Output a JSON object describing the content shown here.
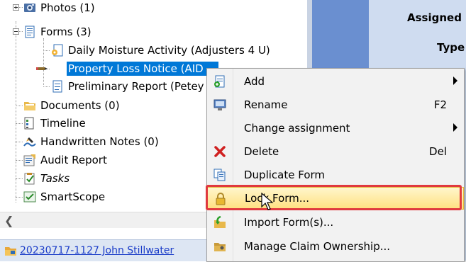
{
  "tree": {
    "items": [
      {
        "label": "Photos (1)",
        "icon": "photo-icon"
      },
      {
        "label": "Forms (3)",
        "icon": "forms-icon"
      },
      {
        "label": "Daily Moisture Activity (Adjusters 4 U)",
        "icon": "form-shared-icon"
      },
      {
        "label": "Property Loss Notice (AID ...",
        "icon": "form-edit-icon",
        "selected": true
      },
      {
        "label": "Preliminary Report (Petey",
        "icon": "form-icon"
      },
      {
        "label": "Documents (0)",
        "icon": "folder-icon"
      },
      {
        "label": "Timeline",
        "icon": "timeline-icon"
      },
      {
        "label": "Handwritten Notes (0)",
        "icon": "pen-icon"
      },
      {
        "label": "Audit Report",
        "icon": "report-icon"
      },
      {
        "label": "Tasks",
        "icon": "tasks-icon",
        "italic": true
      },
      {
        "label": "SmartScope",
        "icon": "smartscope-icon"
      }
    ]
  },
  "claim": {
    "label": "20230717-1127 John Stillwater",
    "icon": "claim-folder-icon"
  },
  "right_panel": {
    "assigned_label": "Assigned",
    "type_label": "Type"
  },
  "context_menu": {
    "items": [
      {
        "label": "Add",
        "shortcut": "",
        "submenu": true,
        "icon": "add-icon"
      },
      {
        "label": "Rename",
        "shortcut": "F2",
        "submenu": false,
        "icon": "rename-icon"
      },
      {
        "label": "Change assignment",
        "shortcut": "",
        "submenu": true,
        "icon": ""
      },
      {
        "label": "Delete",
        "shortcut": "Del",
        "submenu": false,
        "icon": "delete-icon"
      },
      {
        "label": "Duplicate Form",
        "shortcut": "",
        "submenu": false,
        "icon": "duplicate-icon"
      },
      {
        "label": "Lock Form...",
        "shortcut": "",
        "submenu": false,
        "icon": "lock-icon",
        "hover": true
      },
      {
        "label": "Import Form(s)...",
        "shortcut": "",
        "submenu": false,
        "icon": "import-icon"
      },
      {
        "label": "Manage Claim Ownership...",
        "shortcut": "",
        "submenu": false,
        "icon": "ownership-icon"
      }
    ]
  },
  "colors": {
    "selection": "#0078d7",
    "hover_highlight": "#ffe080",
    "callout": "#e0393e",
    "link": "#1a3cc8"
  }
}
